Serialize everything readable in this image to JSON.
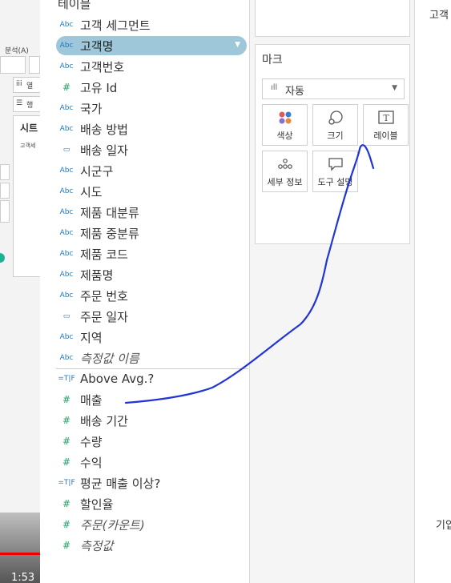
{
  "left_strip": {
    "menu_label": "분석(A)",
    "col_label": "열",
    "row_label": "행",
    "sheet_title": "시트",
    "sheet_sub": "고객세",
    "video_time": "1:53"
  },
  "data_pane": {
    "section_title": "테이블",
    "fields": [
      {
        "type": "Abc",
        "label": "고객 세그먼트"
      },
      {
        "type": "Abc",
        "label": "고객명",
        "selected": true
      },
      {
        "type": "Abc",
        "label": "고객번호"
      },
      {
        "type": "#",
        "label": "고유 Id"
      },
      {
        "type": "Abc",
        "label": "국가"
      },
      {
        "type": "Abc",
        "label": "배송 방법"
      },
      {
        "type": "date",
        "label": "배송 일자"
      },
      {
        "type": "Abc",
        "label": "시군구"
      },
      {
        "type": "Abc",
        "label": "시도"
      },
      {
        "type": "Abc",
        "label": "제품 대분류"
      },
      {
        "type": "Abc",
        "label": "제품 중분류"
      },
      {
        "type": "Abc",
        "label": "제품 코드"
      },
      {
        "type": "Abc",
        "label": "제품명"
      },
      {
        "type": "Abc",
        "label": "주문 번호"
      },
      {
        "type": "date",
        "label": "주문 일자"
      },
      {
        "type": "Abc",
        "label": "지역"
      },
      {
        "type": "Abc",
        "label": "측정값 이름",
        "italic": true
      },
      {
        "type": "=T|F",
        "label": "Above Avg.?"
      },
      {
        "type": "#",
        "label": "매출"
      },
      {
        "type": "#",
        "label": "배송 기간"
      },
      {
        "type": "#",
        "label": "수량"
      },
      {
        "type": "#",
        "label": "수익"
      },
      {
        "type": "=T|F",
        "label": "평균 매출 이상?"
      },
      {
        "type": "#",
        "label": "할인율"
      },
      {
        "type": "#",
        "label": "주문(카운트)",
        "italic": true
      },
      {
        "type": "#",
        "label": "측정값",
        "italic": true
      }
    ]
  },
  "marks": {
    "title": "마크",
    "mark_type": "자동",
    "buttons": [
      {
        "label": "색상",
        "icon": "color-icon"
      },
      {
        "label": "크기",
        "icon": "size-icon"
      },
      {
        "label": "레이블",
        "icon": "label-icon"
      },
      {
        "label": "세부 정보",
        "icon": "detail-icon"
      },
      {
        "label": "도구 설명",
        "icon": "tooltip-icon"
      }
    ]
  },
  "right_edge": {
    "top_label": "고객",
    "bottom_label": "기입"
  },
  "colors": {
    "selected_pill": "#9ec7d9",
    "dimension_icon": "#2a78b5",
    "measure_icon": "#21a366",
    "annotation": "#1f35d6"
  }
}
